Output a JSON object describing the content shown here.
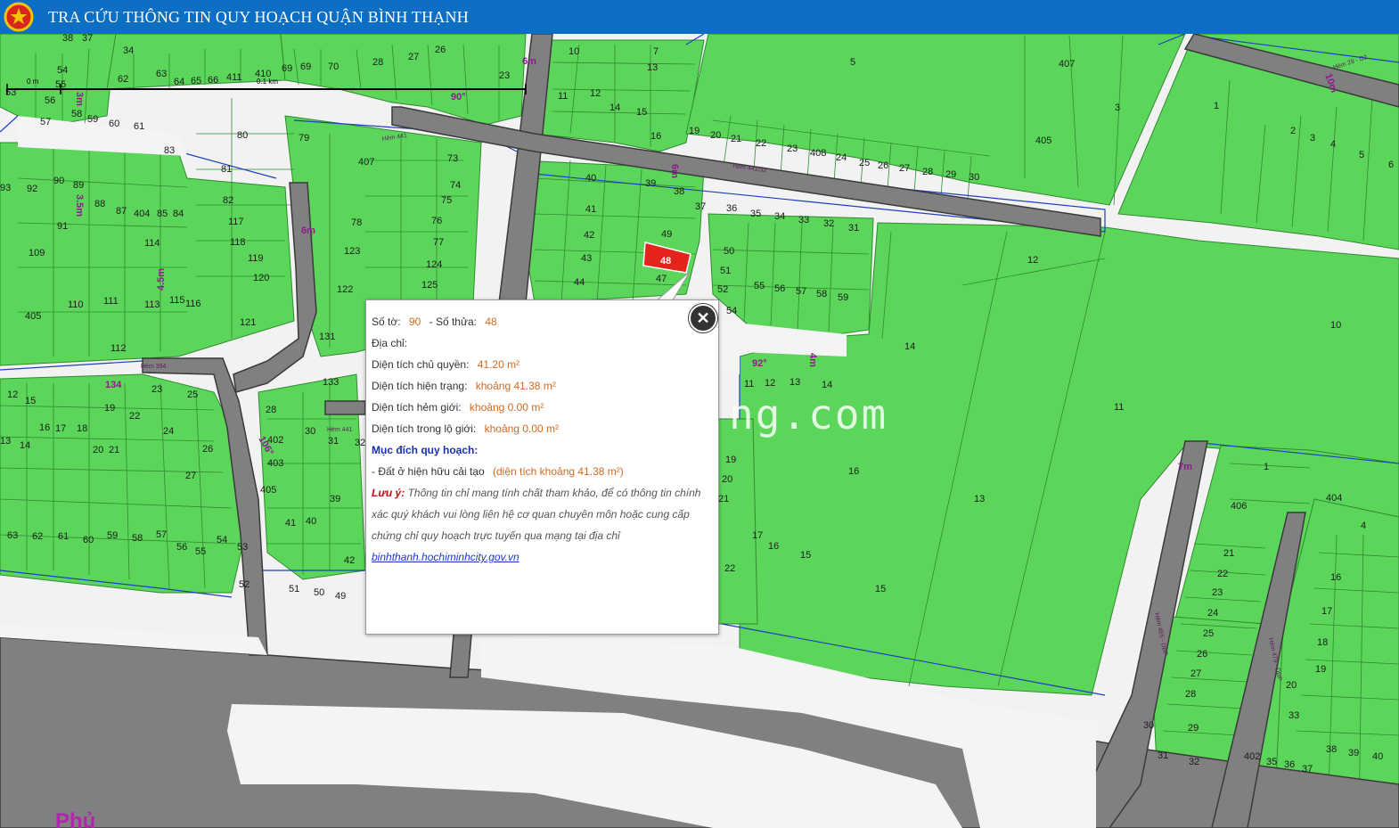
{
  "header": {
    "title": "TRA CỨU THÔNG TIN QUY HOẠCH QUẬN BÌNH THẠNH"
  },
  "scale_bar": {
    "zero_label": "0 m",
    "distance_label": "0.1 km"
  },
  "map": {
    "watermark": "ng.com",
    "selected_lot_label": "48",
    "street_labels": [
      "Hẻm 441",
      "Hẻm 441/32",
      "Hẻm 441",
      "Hẻm 394",
      "Hẻm 29 - D2",
      "Hẻm 455 - DBP",
      "Hẻm 479 - DBP"
    ],
    "dimension_labels": [
      "3m",
      "3.5m",
      "4.5m",
      "6m",
      "6m",
      "6m",
      "4m",
      "7m",
      "10m",
      "90°",
      "106°",
      "92°",
      "134"
    ],
    "district_label": "Phủ",
    "lot_numbers": [
      "38",
      "37",
      "34",
      "54",
      "55",
      "56",
      "57",
      "58",
      "59",
      "60",
      "61",
      "62",
      "63",
      "64",
      "65",
      "66",
      "411",
      "410",
      "69",
      "70",
      "28",
      "27",
      "26",
      "24",
      "23",
      "10",
      "11",
      "12",
      "14",
      "15",
      "16",
      "17",
      "18",
      "7",
      "13",
      "19",
      "20",
      "21",
      "22",
      "23",
      "408",
      "24",
      "25",
      "26",
      "27",
      "28",
      "29",
      "30",
      "5",
      "407",
      "405",
      "3",
      "1",
      "2",
      "3",
      "4",
      "5",
      "6",
      "53",
      "83",
      "80",
      "79",
      "407",
      "81",
      "82",
      "117",
      "118",
      "119",
      "120",
      "121",
      "122",
      "123",
      "124",
      "125",
      "78",
      "76",
      "77",
      "74",
      "75",
      "73",
      "93",
      "92",
      "90",
      "89",
      "88",
      "404",
      "85",
      "84",
      "91",
      "114",
      "109",
      "110",
      "111",
      "113",
      "115",
      "116",
      "405",
      "112",
      "40",
      "41",
      "42",
      "43",
      "44",
      "39",
      "38",
      "37",
      "36",
      "35",
      "34",
      "33",
      "32",
      "31",
      "12",
      "49",
      "50",
      "51",
      "52",
      "53",
      "54",
      "55",
      "56",
      "57",
      "58",
      "59",
      "47",
      "14",
      "10",
      "11",
      "12",
      "13",
      "14",
      "11",
      "16",
      "13",
      "19",
      "20",
      "21",
      "22",
      "17",
      "16",
      "15",
      "15",
      "12",
      "15",
      "16",
      "17",
      "18",
      "19",
      "20",
      "21",
      "22",
      "23",
      "24",
      "25",
      "26",
      "27",
      "13",
      "14",
      "63",
      "62",
      "61",
      "60",
      "59",
      "58",
      "57",
      "56",
      "55",
      "54",
      "53",
      "52",
      "51",
      "50",
      "49",
      "28",
      "30",
      "31",
      "32",
      "133",
      "131",
      "402",
      "403",
      "405",
      "39",
      "40",
      "41",
      "42",
      "1",
      "406",
      "404",
      "4",
      "16",
      "17",
      "18",
      "19",
      "20",
      "21",
      "22",
      "23",
      "24",
      "25",
      "26",
      "27",
      "28",
      "29",
      "30",
      "31",
      "32",
      "33",
      "38",
      "39",
      "40",
      "402",
      "35",
      "36",
      "37"
    ]
  },
  "popup": {
    "so_to_label": "Số tờ:",
    "so_to_value": "90",
    "so_thua_label": "- Số thửa:",
    "so_thua_value": "48",
    "dia_chi_label": "Địa chỉ:",
    "dien_tich_chu_quyen_label": "Diện tích chủ quyền:",
    "dien_tich_chu_quyen_value": "41.20 m²",
    "dien_tich_hien_trang_label": "Diện tích hiện trạng:",
    "dien_tich_hien_trang_value": "khoảng 41.38 m²",
    "dien_tich_hem_gioi_label": "Diện tích hẻm giới:",
    "dien_tich_hem_gioi_value": "khoảng 0.00 m²",
    "dien_tich_lo_gioi_label": "Diện tích trong lộ giới:",
    "dien_tich_lo_gioi_value": "khoảng 0.00 m²",
    "muc_dich_label": "Mục đích quy hoạch:",
    "muc_dich_item": "- Đất ở hiện hữu cải tạo",
    "muc_dich_area": "(diện tích khoảng 41.38 m²)",
    "note_label": "Lưu ý:",
    "note_text": "Thông tin chỉ mang tính chất tham khảo, để có thông tin chính xác quý khách vui lòng liên hệ cơ quan chuyên môn hoặc cung cấp chứng chỉ quy hoạch trực tuyến qua mạng tại địa chỉ",
    "note_link": "binhthanh.hochiminhcity.gov.vn",
    "close_icon": "close-icon"
  },
  "colors": {
    "header": "#0d6fc4",
    "parcel": "#5bd65b",
    "parcel_border": "#2e8b2e",
    "road": "#808080",
    "selected_parcel": "#e3231c",
    "boundary": "#1f3fbf"
  }
}
